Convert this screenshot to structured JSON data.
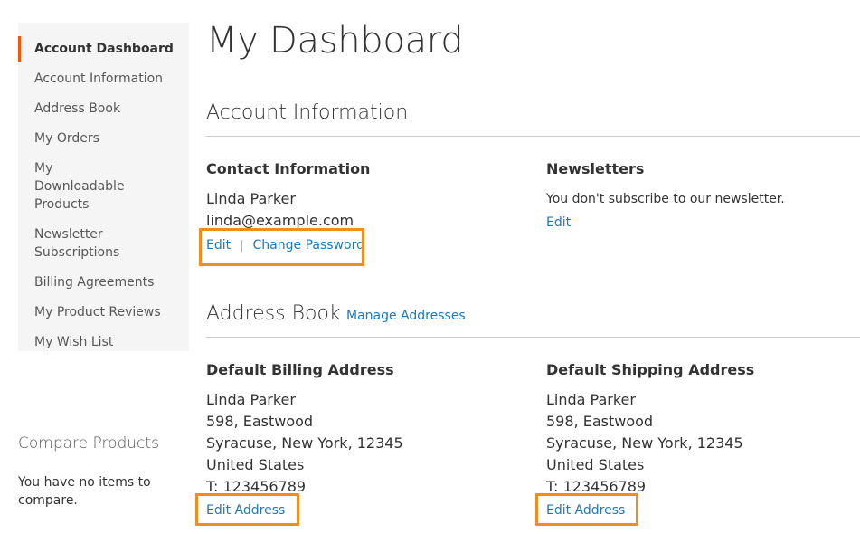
{
  "sidebar": {
    "items": [
      {
        "label": "Account Dashboard",
        "active": true
      },
      {
        "label": "Account Information"
      },
      {
        "label": "Address Book"
      },
      {
        "label": "My Orders"
      },
      {
        "label": "My Downloadable Products"
      },
      {
        "label": "Newsletter Subscriptions"
      },
      {
        "label": "Billing Agreements"
      },
      {
        "label": "My Product Reviews"
      },
      {
        "label": "My Wish List"
      }
    ]
  },
  "compare": {
    "title": "Compare Products",
    "empty_text": "You have no items to compare."
  },
  "page": {
    "title": "My Dashboard"
  },
  "account_info": {
    "section_title": "Account Information",
    "contact": {
      "title": "Contact Information",
      "name": "Linda Parker",
      "email": "linda@example.com",
      "edit_label": "Edit",
      "change_password_label": "Change Password"
    },
    "newsletters": {
      "title": "Newsletters",
      "text": "You don't subscribe to our newsletter.",
      "edit_label": "Edit"
    }
  },
  "address_book": {
    "section_title": "Address Book",
    "manage_label": "Manage Addresses",
    "billing": {
      "title": "Default Billing Address",
      "lines": [
        "Linda Parker",
        "598, Eastwood",
        "Syracuse, New York, 12345",
        "United States",
        "T: 123456789"
      ],
      "edit_label": "Edit Address"
    },
    "shipping": {
      "title": "Default Shipping Address",
      "lines": [
        "Linda Parker",
        "598, Eastwood",
        "Syracuse, New York, 12345",
        "United States",
        "T: 123456789"
      ],
      "edit_label": "Edit Address"
    }
  },
  "colors": {
    "accent_active": "#ff5501",
    "link": "#1979c3",
    "highlight_border": "#f58a1f",
    "sidebar_bg": "#f5f5f5"
  }
}
